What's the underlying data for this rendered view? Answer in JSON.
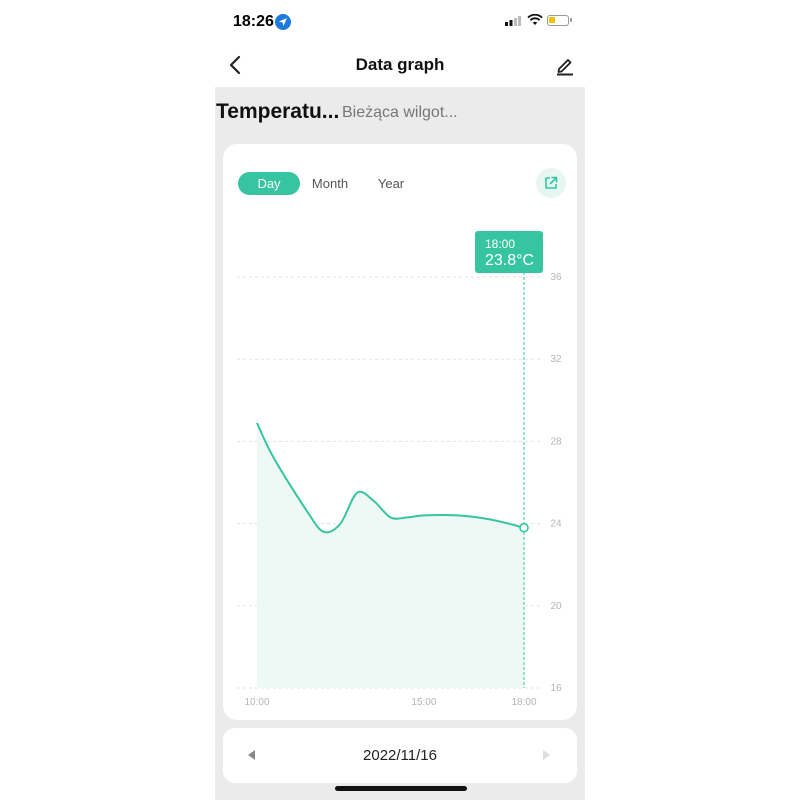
{
  "status_bar": {
    "time": "18:26"
  },
  "header": {
    "title": "Data graph"
  },
  "metric_tabs": {
    "active": "Temperatu...",
    "inactive": "Bieżąca wilgot..."
  },
  "period_tabs": [
    {
      "label": "Day",
      "active": true
    },
    {
      "label": "Month",
      "active": false
    },
    {
      "label": "Year",
      "active": false
    }
  ],
  "tooltip": {
    "time": "18:00",
    "value": "23.8°C"
  },
  "date_nav": {
    "date": "2022/11/16"
  },
  "colors": {
    "accent": "#36c5a0",
    "area": "#eef8f4",
    "grid": "#e3e3e3"
  },
  "chart_data": {
    "type": "area",
    "title": "",
    "xlabel": "",
    "ylabel": "",
    "x_tick_labels": [
      "10:00",
      "15:00",
      "18:00"
    ],
    "y_ticks": [
      16,
      20,
      24,
      28,
      32,
      36
    ],
    "ylim": [
      16,
      36
    ],
    "y_axis_side": "right",
    "grid": true,
    "series": [
      {
        "x": [
          10.0,
          10.5,
          11.5,
          12.0,
          12.5,
          13.0,
          13.5,
          14.0,
          14.5,
          15.0,
          16.0,
          17.0,
          18.0
        ],
        "y": [
          28.9,
          27.2,
          24.6,
          23.6,
          24.0,
          25.5,
          25.1,
          24.3,
          24.3,
          24.4,
          24.4,
          24.2,
          23.8
        ]
      }
    ],
    "highlight": {
      "x": 18.0,
      "y": 23.8
    }
  }
}
